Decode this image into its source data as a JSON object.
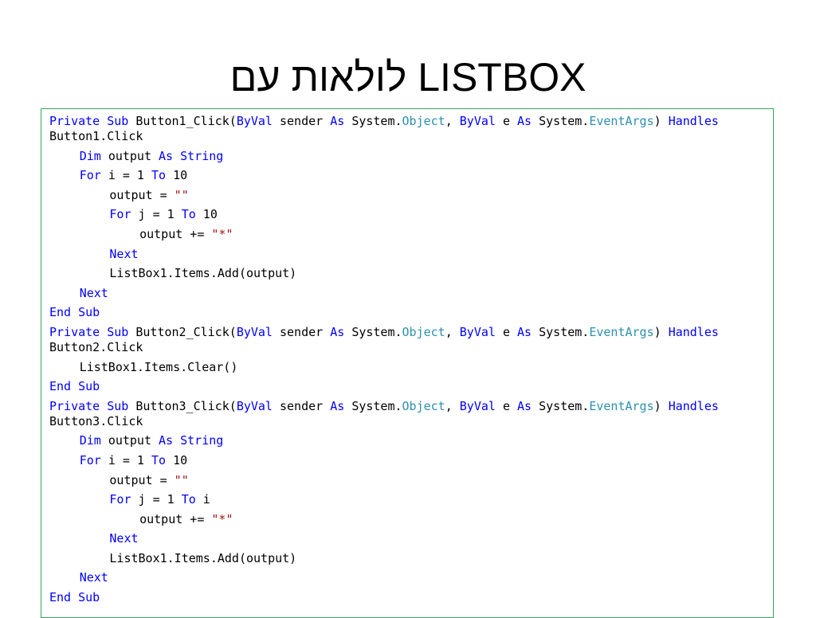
{
  "slide": {
    "title": "לולאות עם LISTBOX"
  },
  "code": {
    "sub1": {
      "header": [
        "Private",
        "Sub",
        "Button1_Click(",
        "ByVal",
        "sender",
        "As",
        "System.",
        "Object",
        ",",
        "ByVal",
        "e",
        "As",
        "System.",
        "EventArgs",
        ")",
        "Handles"
      ],
      "handles_target": "Button1.Click",
      "dim_kw": "Dim",
      "dim_var": "output",
      "dim_as": "As",
      "dim_type": "String",
      "for_outer_kw": "For",
      "for_outer_expr": "i = 1",
      "for_outer_to": "To",
      "for_outer_end": "10",
      "assign_lhs": "output =",
      "assign_rhs": "\"\"",
      "for_inner_kw": "For",
      "for_inner_expr": "j = 1",
      "for_inner_to": "To",
      "for_inner_end": "10",
      "append_lhs": "output +=",
      "append_rhs": "\"*\"",
      "next_inner": "Next",
      "add_stmt": "ListBox1.Items.Add(output)",
      "next_outer": "Next",
      "end_kw1": "End",
      "end_kw2": "Sub"
    },
    "sub2": {
      "header": [
        "Private",
        "Sub",
        "Button2_Click(",
        "ByVal",
        "sender",
        "As",
        "System.",
        "Object",
        ",",
        "ByVal",
        "e",
        "As",
        "System.",
        "EventArgs",
        ")",
        "Handles"
      ],
      "handles_target": "Button2.Click",
      "clear_stmt": "ListBox1.Items.Clear()",
      "end_kw1": "End",
      "end_kw2": "Sub"
    },
    "sub3": {
      "header": [
        "Private",
        "Sub",
        "Button3_Click(",
        "ByVal",
        "sender",
        "As",
        "System.",
        "Object",
        ",",
        "ByVal",
        "e",
        "As",
        "System.",
        "EventArgs",
        ")",
        "Handles"
      ],
      "handles_target": "Button3.Click",
      "dim_kw": "Dim",
      "dim_var": "output",
      "dim_as": "As",
      "dim_type": "String",
      "for_outer_kw": "For",
      "for_outer_expr": "i = 1",
      "for_outer_to": "To",
      "for_outer_end": "10",
      "assign_lhs": "output =",
      "assign_rhs": "\"\"",
      "for_inner_kw": "For",
      "for_inner_expr": "j = 1",
      "for_inner_to": "To",
      "for_inner_end": "i",
      "append_lhs": "output +=",
      "append_rhs": "\"*\"",
      "next_inner": "Next",
      "add_stmt": "ListBox1.Items.Add(output)",
      "next_outer": "Next",
      "end_kw1": "End",
      "end_kw2": "Sub"
    }
  },
  "colors": {
    "keyword": "#0000ff",
    "type": "#2b91af",
    "string": "#a31515",
    "border": "#3aa35a"
  }
}
